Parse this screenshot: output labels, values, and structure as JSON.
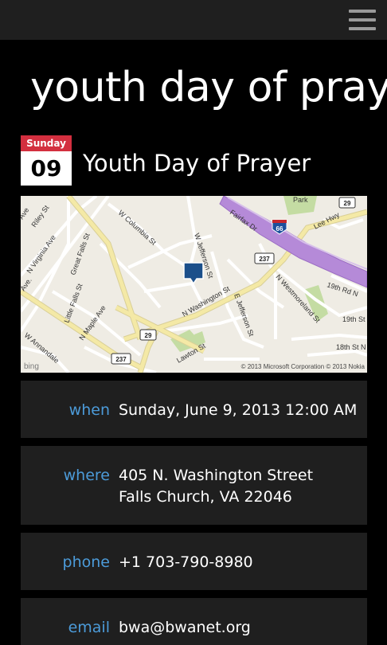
{
  "header": {
    "menu_icon": "hamburger-menu-icon"
  },
  "page": {
    "title": "youth day of pray"
  },
  "event": {
    "day_name": "Sunday",
    "day_number": "09",
    "title": "Youth Day of Prayer"
  },
  "map": {
    "streets": [
      "Riley St",
      "N Virginia Ave",
      "Great Falls St",
      "W Columbia St",
      "Fairfax Dr",
      "Lee Hwy",
      "Park",
      "W Jefferson St",
      "N Washington St",
      "E Jefferson St",
      "N Westmoreland St",
      "19th Rd N",
      "19th St",
      "18th St N",
      "Little Falls St",
      "N Maple Ave",
      "Lawton St",
      "W Annandale",
      "Ave",
      "Ave."
    ],
    "shields": [
      "66",
      "29",
      "237",
      "29",
      "237"
    ],
    "brand": "bing",
    "copyright": "© 2013 Microsoft Corporation © 2013 Nokia",
    "colors": {
      "interstate": "#b58ad8",
      "park": "#c4dca3",
      "highway": "#f4e9a6",
      "pin": "#1b4f8a"
    }
  },
  "details": {
    "when": {
      "label": "when",
      "value": "Sunday, June 9, 2013 12:00 AM"
    },
    "where": {
      "label": "where",
      "line1": "405 N. Washington Street",
      "line2": "Falls Church, VA 22046"
    },
    "phone": {
      "label": "phone",
      "value": "+1 703-790-8980"
    },
    "email": {
      "label": "email",
      "value": "bwa@bwanet.org"
    }
  },
  "colors": {
    "accent": "#4c9bd9",
    "calendar_red": "#d32f3f",
    "card_bg": "#1f1f1f"
  }
}
